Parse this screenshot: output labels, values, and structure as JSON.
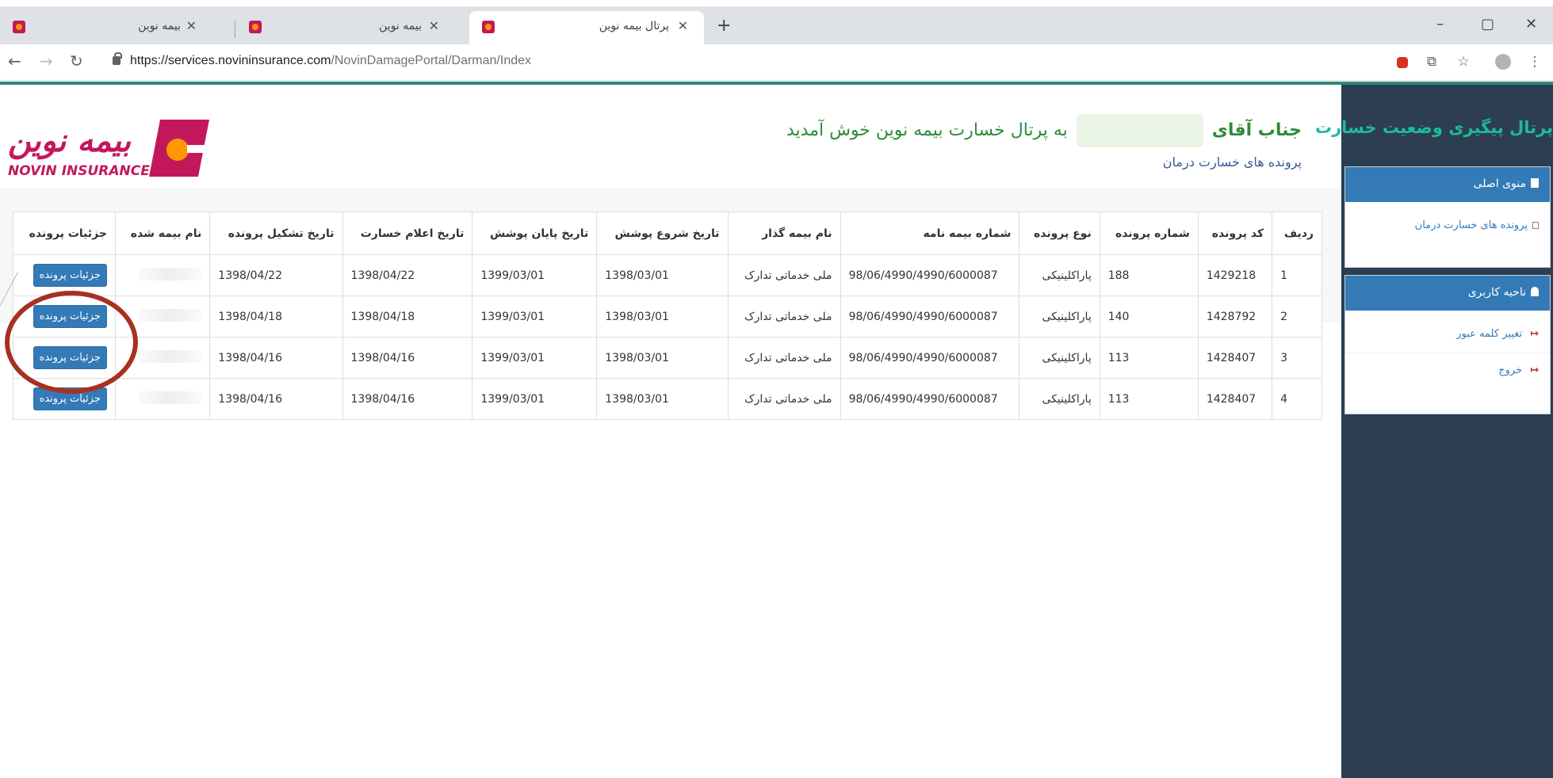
{
  "browser": {
    "tabs": [
      {
        "title": "بیمه نوین",
        "active": false
      },
      {
        "title": "بیمه نوین",
        "active": false
      },
      {
        "title": "پرتال بیمه نوین",
        "active": true
      }
    ],
    "new_tab": "+",
    "window": {
      "minimize": "–",
      "maximize": "▢",
      "close": "✕"
    },
    "url_host": "https://services.novininsurance.com",
    "url_path": "/NovinDamagePortal/Darman/Index"
  },
  "sidebar": {
    "portal_title": "پرتال پیگیری وضعیت خسارت",
    "main_menu": {
      "title": "منوی اصلی",
      "items": [
        "پرونده های خسارت درمان"
      ]
    },
    "user_area": {
      "title": "ناحیه کاربری",
      "items": [
        "تغییر کلمه عبور",
        "خروج"
      ]
    }
  },
  "header": {
    "logo_fa": "بیمه نوین",
    "logo_en": "NOVIN INSURANCE",
    "greeting_prefix": "جناب آقای",
    "greeting_suffix": "به پرتال خسارت بیمه نوین خوش آمدید",
    "subtitle": "پرونده های خسارت درمان"
  },
  "table": {
    "headers": [
      "ردیف",
      "کد پرونده",
      "شماره پرونده",
      "نوع پرونده",
      "شماره بیمه نامه",
      "نام بیمه گذار",
      "تاریخ شروع پوشش",
      "تاریخ پایان پوشش",
      "تاریخ اعلام خسارت",
      "تاریخ تشکیل پرونده",
      "نام بیمه شده",
      "جزئیات پرونده"
    ],
    "button_label": "جزئیات پرونده",
    "rows": [
      [
        "1",
        "1429218",
        "188",
        "پاراکلینیکی",
        "98/06/4990/4990/6000087",
        "ملی خدماتی تدارک",
        "1398/03/01",
        "1399/03/01",
        "1398/04/22",
        "1398/04/22"
      ],
      [
        "2",
        "1428792",
        "140",
        "پاراکلینیکی",
        "98/06/4990/4990/6000087",
        "ملی خدماتی تدارک",
        "1398/03/01",
        "1399/03/01",
        "1398/04/18",
        "1398/04/18"
      ],
      [
        "3",
        "1428407",
        "113",
        "پاراکلینیکی",
        "98/06/4990/4990/6000087",
        "ملی خدماتی تدارک",
        "1398/03/01",
        "1399/03/01",
        "1398/04/16",
        "1398/04/16"
      ],
      [
        "4",
        "1428407",
        "113",
        "پاراکلینیکی",
        "98/06/4990/4990/6000087",
        "ملی خدماتی تدارک",
        "1398/03/01",
        "1399/03/01",
        "1398/04/16",
        "1398/04/16"
      ]
    ]
  },
  "colors": {
    "accent": "#337ab7",
    "sidebar": "#2d3e50",
    "portal_title": "#1abc9c",
    "highlight_circle": "#a83020"
  }
}
